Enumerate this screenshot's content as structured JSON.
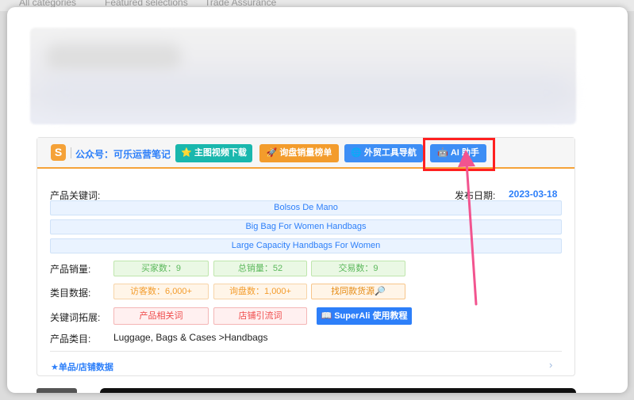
{
  "topnav": [
    "All categories",
    "Featured selections",
    "Trade Assurance"
  ],
  "toolbar": {
    "logo_text": "S",
    "account_label": "公众号：可乐运营笔记",
    "buttons": [
      {
        "icon": "⭐",
        "label": "主图视频下载",
        "color": "#19b7ad"
      },
      {
        "icon": "🚀",
        "label": "询盘销量榜单",
        "color": "#f39c2c"
      },
      {
        "icon": "🌐",
        "label": "外贸工具导航",
        "color": "#3d8ef5"
      },
      {
        "icon": "🤖",
        "label": "AI 助手",
        "color": "#3d8ef5"
      }
    ]
  },
  "product": {
    "keywords_label": "产品关键词:",
    "release_label": "发布日期:",
    "release_date": "2023-03-18",
    "keywords": [
      "Bolsos De Mano",
      "Big Bag For Women Handbags",
      "Large Capacity Handbags For Women"
    ],
    "sales_label": "产品销量:",
    "sales": [
      "买家数：9",
      "总销量：52",
      "交易数：9"
    ],
    "category_data_label": "类目数据:",
    "category_data": [
      "访客数：6,000+",
      "询盘数：1,000+",
      "找同款货源🔎"
    ],
    "keyword_ext_label": "关键词拓展:",
    "keyword_ext": [
      "产品相关词",
      "店铺引流词",
      "📖 SuperAli 使用教程"
    ],
    "category_label": "产品类目:",
    "category_value": "Luggage, Bags & Cases >Handbags",
    "shop_link": "★单品/店铺数据",
    "chevron": "›"
  },
  "colors": {
    "accent": "#2d7ff9",
    "highlight": "#ff2020",
    "arrow": "#f2548f"
  }
}
